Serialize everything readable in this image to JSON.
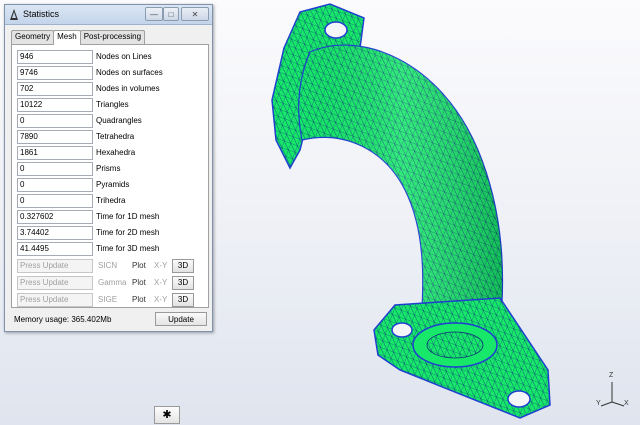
{
  "window": {
    "title": "Statistics",
    "minimize_glyph": "—",
    "maximize_glyph": "□",
    "close_glyph": "✕"
  },
  "tabs": [
    {
      "label": "Geometry",
      "active": false
    },
    {
      "label": "Mesh",
      "active": true
    },
    {
      "label": "Post-processing",
      "active": false
    }
  ],
  "stats": [
    {
      "value": "946",
      "label": "Nodes on Lines"
    },
    {
      "value": "9746",
      "label": "Nodes on surfaces"
    },
    {
      "value": "702",
      "label": "Nodes in volumes"
    },
    {
      "value": "10122",
      "label": "Triangles"
    },
    {
      "value": "0",
      "label": "Quadrangles"
    },
    {
      "value": "7890",
      "label": "Tetrahedra"
    },
    {
      "value": "1861",
      "label": "Hexahedra"
    },
    {
      "value": "0",
      "label": "Prisms"
    },
    {
      "value": "0",
      "label": "Pyramids"
    },
    {
      "value": "0",
      "label": "Trihedra"
    },
    {
      "value": "0.327602",
      "label": "Time for 1D mesh"
    },
    {
      "value": "3.74402",
      "label": "Time for 2D mesh"
    },
    {
      "value": "41.4495",
      "label": "Time for 3D mesh"
    }
  ],
  "quality": [
    {
      "placeholder": "Press Update",
      "name": "SICN",
      "plot": "Plot",
      "xy": "X-Y",
      "btn3d": "3D"
    },
    {
      "placeholder": "Press Update",
      "name": "Gamma",
      "plot": "Plot",
      "xy": "X-Y",
      "btn3d": "3D"
    },
    {
      "placeholder": "Press Update",
      "name": "SIGE",
      "plot": "Plot",
      "xy": "X-Y",
      "btn3d": "3D"
    }
  ],
  "status": {
    "memory": "Memory usage: 365.402Mb",
    "update_label": "Update"
  },
  "axes": {
    "z": "Z",
    "y": "Y",
    "x": "X"
  },
  "gear_glyph": "✱",
  "colors": {
    "mesh_fill": "#17e86a",
    "mesh_edges": "#0d2a7a",
    "mesh_boundary": "#1f3fcf",
    "titlebar": "#c3d4ea"
  }
}
